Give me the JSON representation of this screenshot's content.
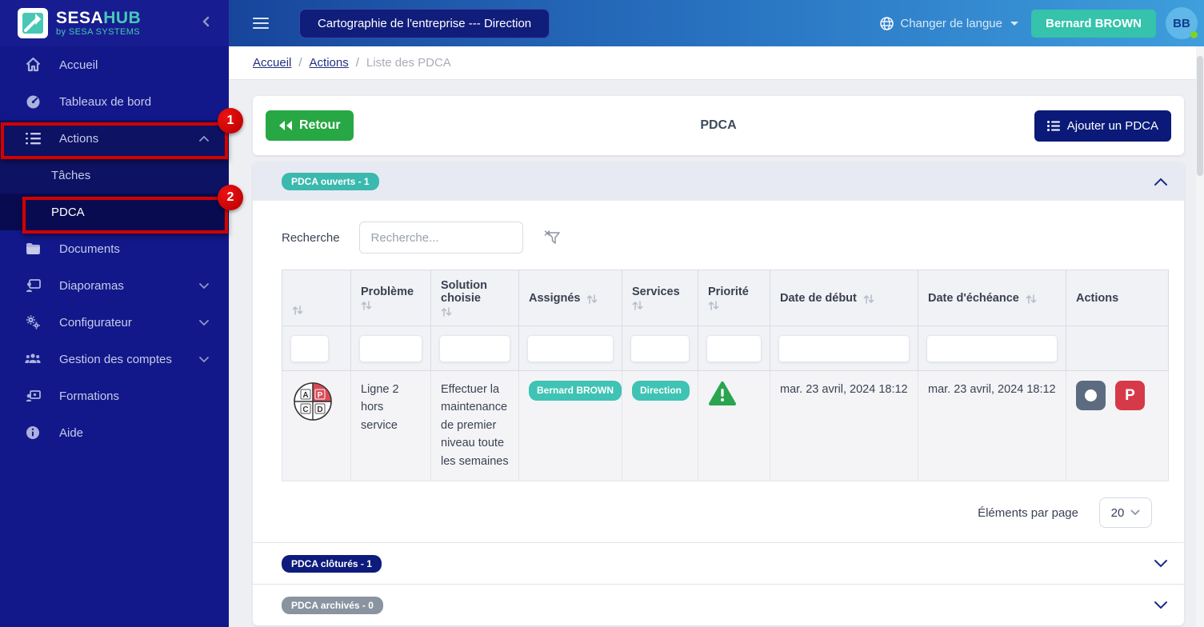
{
  "colors": {
    "sidebar_navy": "#12188a",
    "primary_navy": "#0d1b7c",
    "accent_teal": "#3ec3b4",
    "success_green": "#28a745",
    "danger_red": "#d63a49",
    "annotation_red": "#d40000",
    "topbar_gradient_start": "#17459c",
    "topbar_gradient_end": "#3f9edc"
  },
  "sidebar": {
    "logo": {
      "brand_sesa": "SESA",
      "brand_hub": "HUB",
      "tagline": "by SESA SYSTEMS"
    },
    "items": [
      {
        "label": "Accueil"
      },
      {
        "label": "Tableaux de bord"
      },
      {
        "label": "Actions"
      },
      {
        "label": "Tâches"
      },
      {
        "label": "PDCA"
      },
      {
        "label": "Documents"
      },
      {
        "label": "Diaporamas"
      },
      {
        "label": "Configurateur"
      },
      {
        "label": "Gestion des comptes"
      },
      {
        "label": "Formations"
      },
      {
        "label": "Aide"
      }
    ]
  },
  "annotations": {
    "step1": "1",
    "step2": "2"
  },
  "topbar": {
    "context_pill": "Cartographie de l'entreprise --- Direction",
    "language_label": "Changer de langue",
    "user_button": "Bernard BROWN",
    "avatar_initials": "BB"
  },
  "breadcrumb": {
    "items": [
      {
        "label": "Accueil"
      },
      {
        "label": "Actions"
      },
      {
        "label": "Liste des PDCA"
      }
    ],
    "separator": "/"
  },
  "page": {
    "back_button": "Retour",
    "title": "PDCA",
    "add_button": "Ajouter un PDCA"
  },
  "sections": {
    "open_badge": "PDCA ouverts - 1",
    "closed_badge": "PDCA clôturés - 1",
    "archived_badge": "PDCA archivés - 0"
  },
  "search": {
    "label": "Recherche",
    "placeholder": "Recherche..."
  },
  "table": {
    "columns": [
      "",
      "Problème",
      "Solution choisie",
      "Assignés",
      "Services",
      "Priorité",
      "Date de début",
      "Date d'échéance",
      "Actions"
    ],
    "rows": [
      {
        "pdca": [
          "A",
          "P",
          "C",
          "D"
        ],
        "problem": "Ligne 2 hors service",
        "solution": "Effectuer la maintenance de premier niveau toute les semaines",
        "assignees": [
          "Bernard BROWN"
        ],
        "services": [
          "Direction"
        ],
        "priority": "green-warning",
        "start_date": "mar. 23 avril, 2024 18:12",
        "due_date": "mar. 23 avril, 2024 18:12",
        "action_p_label": "P"
      }
    ]
  },
  "pagination": {
    "label": "Éléments par page",
    "per_page": "20"
  }
}
